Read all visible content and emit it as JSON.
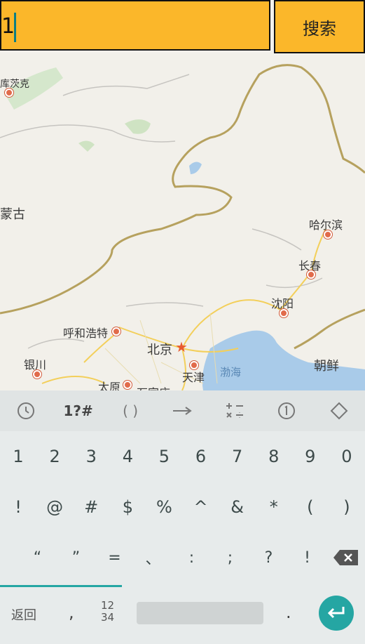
{
  "search": {
    "value": "1",
    "button_label": "搜索"
  },
  "map": {
    "cities": {
      "hohhot_label": "呼和浩特",
      "beijing": "北京",
      "tianjin": "天津",
      "yinchuan": "银川",
      "taiyuan": "太原",
      "shijiazhuang": "石家庄",
      "shenyang": "沈阳",
      "changchun": "长春",
      "harbin": "哈尔滨",
      "korea": "朝鲜",
      "mongolia_partial": "蒙古",
      "choibalsan_partial": "库茨克",
      "bohai": "渤海"
    }
  },
  "keyboard": {
    "toolbar": [
      "🕒",
      "1?#",
      "( )",
      "⟶",
      "±",
      "①",
      "◇"
    ],
    "row1": [
      "1",
      "2",
      "3",
      "4",
      "5",
      "6",
      "7",
      "8",
      "9",
      "0"
    ],
    "row2": [
      "!",
      "@",
      "#",
      "$",
      "%",
      "^",
      "&",
      "*",
      "(",
      ")"
    ],
    "row3": [
      "“",
      "”",
      "=",
      "、",
      ":",
      ";",
      "?",
      "!"
    ],
    "bottom": {
      "back": "返回",
      "comma": ",",
      "num_top": "12",
      "num_bottom": "34",
      "dot": "."
    }
  }
}
